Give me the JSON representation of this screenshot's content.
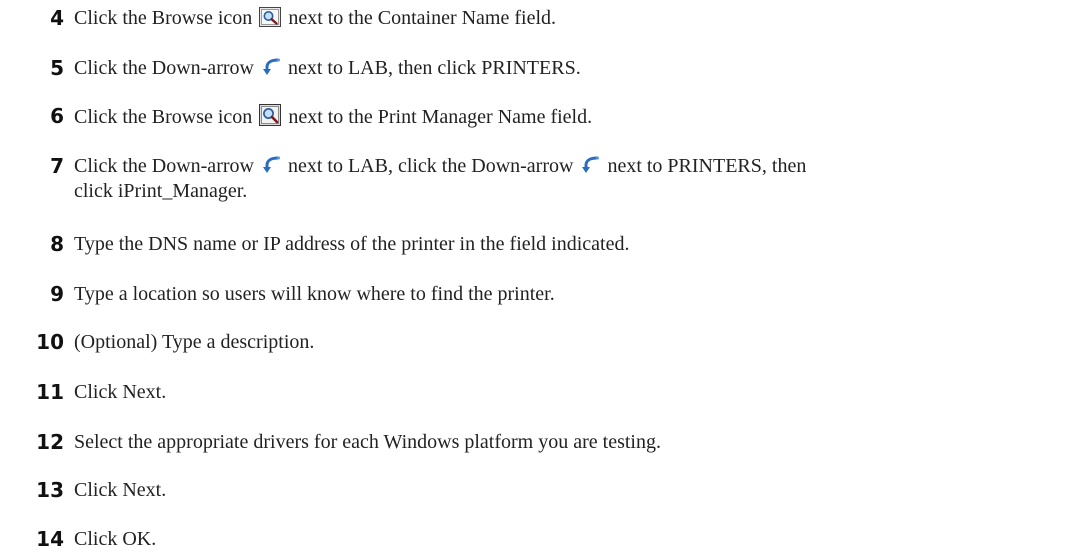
{
  "steps": [
    {
      "number": "4",
      "before": "Click the Browse icon",
      "icon": "browse-icon",
      "after": "next to the Container Name field."
    },
    {
      "number": "5",
      "before": "Click the Down-arrow",
      "icon": "down-arrow-icon",
      "after": "next to LAB, then click PRINTERS."
    },
    {
      "number": "6",
      "before": "Click the Browse icon",
      "icon": "browse-icon",
      "after": "next to the Print Manager Name field."
    },
    {
      "number": "7",
      "part1": "Click the Down-arrow",
      "part2": "next to LAB, click the Down-arrow",
      "part3": "next to PRINTERS, then",
      "part4": "click iPrint_Manager.",
      "icon": "down-arrow-icon"
    },
    {
      "number": "8",
      "text": "Type the DNS name or IP address of the printer in the field indicated."
    },
    {
      "number": "9",
      "text": "Type a location so users will know where to find the printer."
    },
    {
      "number": "10",
      "text": "(Optional) Type a description."
    },
    {
      "number": "11",
      "text": "Click Next."
    },
    {
      "number": "12",
      "text": "Select the appropriate drivers for each Windows platform you are testing."
    },
    {
      "number": "13",
      "text": "Click Next."
    },
    {
      "number": "14",
      "text": "Click OK."
    }
  ]
}
